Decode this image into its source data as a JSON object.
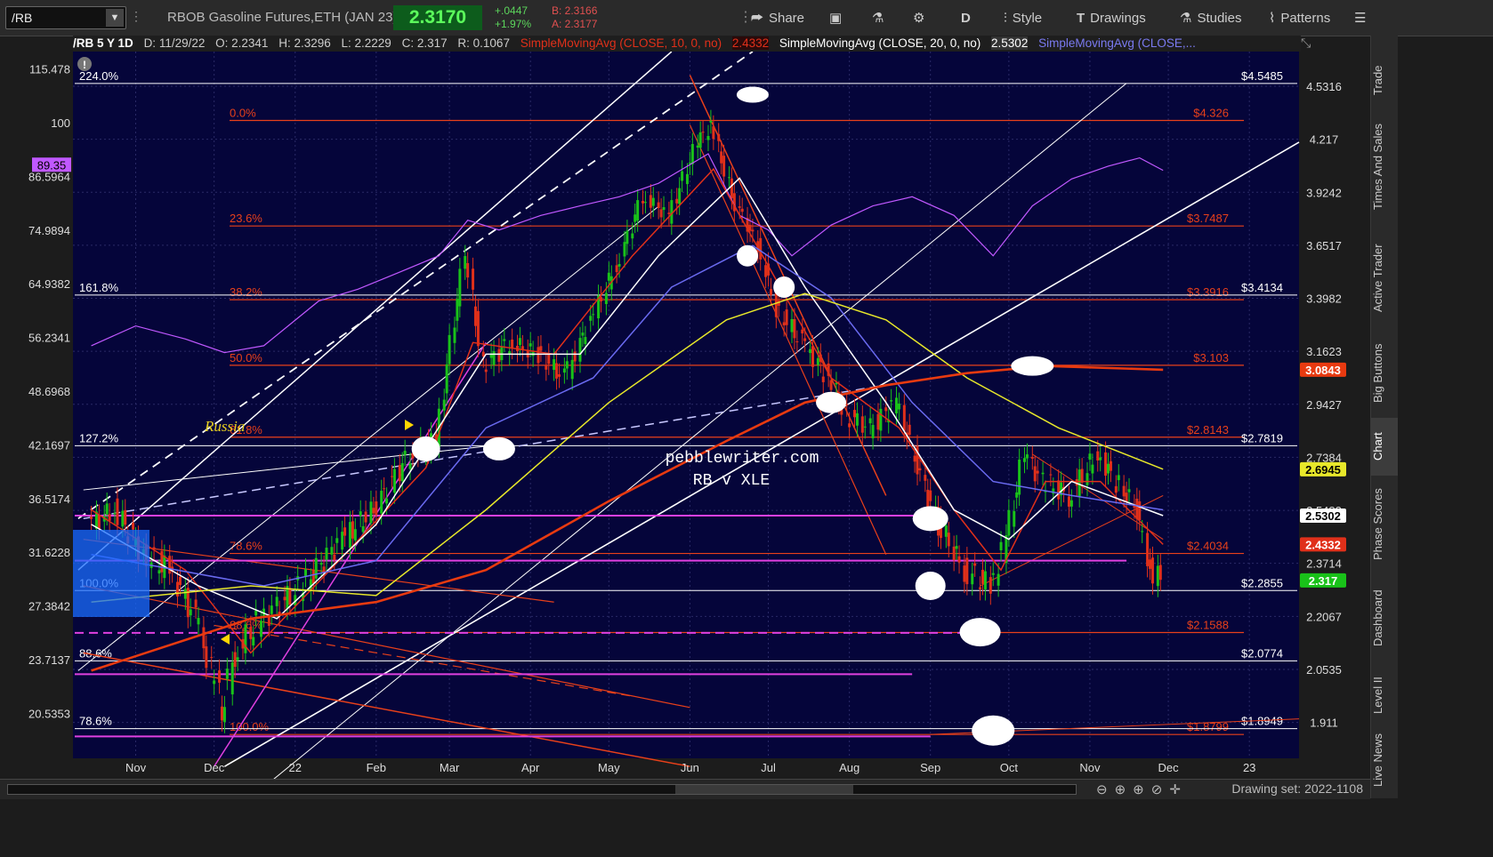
{
  "toolbar": {
    "symbol": "/RB",
    "description": "RBOB Gasoline Futures,ETH (JAN 23)",
    "last_price": "2.3170",
    "change_abs": "+.0447",
    "change_pct": "+1.97%",
    "bid": "B: 2.3166",
    "ask": "A: 2.3177",
    "share_label": "Share",
    "period_label": "D",
    "style_label": "Style",
    "drawings_label": "Drawings",
    "studies_label": "Studies",
    "patterns_label": "Patterns"
  },
  "legend": {
    "header": "/RB 5 Y 1D",
    "date": "D: 11/29/22",
    "open": "O: 2.2341",
    "high": "H: 2.3296",
    "low": "L: 2.2229",
    "close": "C: 2.317",
    "range": "R: 0.1067",
    "sma10": "SimpleMovingAvg (CLOSE, 10, 0, no)",
    "sma10_val": "2.4332",
    "sma20": "SimpleMovingAvg (CLOSE, 20, 0, no)",
    "sma20_val": "2.5302",
    "sma_more": "SimpleMovingAvg (CLOSE,..."
  },
  "colors": {
    "bg": "#05053a",
    "up": "#19c219",
    "down": "#e0301a",
    "sma10": "#e0301a",
    "sma20": "#ffffff",
    "sma50": "#6a6af0",
    "sma100": "#e8e82a",
    "sma200": "#e83a10",
    "xle": "#c058ff",
    "fib": "#e8401a",
    "magenta": "#e040e0"
  },
  "right_tabs": [
    "Trade",
    "Times And Sales",
    "Active Trader",
    "Big Buttons",
    "Chart",
    "Phase Scores",
    "Dashboard",
    "Level II",
    "Live News"
  ],
  "drawing_set": "Drawing set: 2022-1108",
  "chart_data": {
    "type": "candlestick",
    "title": "pebblewriter.com",
    "subtitle": "RB v XLE",
    "annotation": "Russia",
    "x_ticks": [
      {
        "label": "Nov",
        "date": "2021-11-01"
      },
      {
        "label": "Dec",
        "date": "2021-12-01"
      },
      {
        "label": "22",
        "date": "2022-01-01"
      },
      {
        "label": "Feb",
        "date": "2022-02-01"
      },
      {
        "label": "Mar",
        "date": "2022-03-01"
      },
      {
        "label": "Apr",
        "date": "2022-04-01"
      },
      {
        "label": "May",
        "date": "2022-05-01"
      },
      {
        "label": "Jun",
        "date": "2022-06-01"
      },
      {
        "label": "Jul",
        "date": "2022-07-01"
      },
      {
        "label": "Aug",
        "date": "2022-08-01"
      },
      {
        "label": "Sep",
        "date": "2022-09-01"
      },
      {
        "label": "Oct",
        "date": "2022-10-01"
      },
      {
        "label": "Nov",
        "date": "2022-11-01"
      },
      {
        "label": "Dec",
        "date": "2022-12-01"
      },
      {
        "label": "23",
        "date": "2023-01-01"
      }
    ],
    "right_axis": {
      "scale": "log",
      "range": [
        1.82,
        4.75
      ],
      "ticks": [
        "4.5316",
        "4.217",
        "3.9242",
        "3.6517",
        "3.3982",
        "3.1623",
        "2.9427",
        "2.7384",
        "2.5482",
        "2.3714",
        "2.2067",
        "2.0535",
        "1.911"
      ]
    },
    "left_axis": {
      "scale": "log",
      "range": [
        18.2,
        121
      ],
      "ticks": [
        "115.478",
        "100",
        "86.5964",
        "74.9894",
        "64.9382",
        "56.2341",
        "48.6968",
        "42.1697",
        "36.5174",
        "31.6228",
        "27.3842",
        "23.7137",
        "20.5353"
      ]
    },
    "price_tags": [
      {
        "label": "3.0843",
        "value": 3.0843,
        "color": "#e83a10"
      },
      {
        "label": "2.6945",
        "value": 2.6945,
        "color": "#e8e82a"
      },
      {
        "label": "2.5302",
        "value": 2.5302,
        "color": "#ffffff"
      },
      {
        "label": "2.4332",
        "value": 2.4332,
        "color": "#e0301a"
      },
      {
        "label": "2.317",
        "value": 2.317,
        "color": "#19c219"
      }
    ],
    "xle_tag": {
      "label": "89.35",
      "value": 89.35
    },
    "fib_red": [
      {
        "pct": "0.0%",
        "price": "$4.326",
        "value": 4.326
      },
      {
        "pct": "23.6%",
        "price": "$3.7487",
        "value": 3.7487
      },
      {
        "pct": "38.2%",
        "price": "$3.3916",
        "value": 3.3916
      },
      {
        "pct": "50.0%",
        "price": "$3.103",
        "value": 3.103
      },
      {
        "pct": "61.8%",
        "price": "$2.8143",
        "value": 2.8143
      },
      {
        "pct": "78.6%",
        "price": "$2.4034",
        "value": 2.4034
      },
      {
        "pct": "88.6%",
        "price": "$2.1588",
        "value": 2.1588
      },
      {
        "pct": "100.0%",
        "price": "$1.8799",
        "value": 1.8799
      }
    ],
    "fib_white": [
      {
        "pct": "224.0%",
        "price": "$4.5485",
        "value": 4.5485
      },
      {
        "pct": "161.8%",
        "price": "$3.4134",
        "value": 3.4134
      },
      {
        "pct": "127.2%",
        "price": "$2.7819",
        "value": 2.7819
      },
      {
        "pct": "100.0%",
        "price": "$2.2855",
        "value": 2.2855
      },
      {
        "pct": "88.6%",
        "price": "$2.0774",
        "value": 2.0774
      },
      {
        "pct": "78.6%",
        "price": "$1.8949",
        "value": 1.8949
      }
    ],
    "series": [
      {
        "name": "/RB",
        "kind": "close",
        "points": [
          [
            "2021-10-15",
            2.5
          ],
          [
            "2021-10-25",
            2.55
          ],
          [
            "2021-11-05",
            2.4
          ],
          [
            "2021-11-15",
            2.35
          ],
          [
            "2021-11-25",
            2.2
          ],
          [
            "2021-12-01",
            2.05
          ],
          [
            "2021-12-05",
            1.95
          ],
          [
            "2021-12-10",
            2.1
          ],
          [
            "2021-12-20",
            2.2
          ],
          [
            "2022-01-05",
            2.3
          ],
          [
            "2022-01-20",
            2.45
          ],
          [
            "2022-02-01",
            2.55
          ],
          [
            "2022-02-15",
            2.75
          ],
          [
            "2022-02-25",
            2.8
          ],
          [
            "2022-03-05",
            3.4
          ],
          [
            "2022-03-08",
            3.6
          ],
          [
            "2022-03-15",
            3.1
          ],
          [
            "2022-03-25",
            3.2
          ],
          [
            "2022-04-05",
            3.15
          ],
          [
            "2022-04-15",
            3.05
          ],
          [
            "2022-04-25",
            3.3
          ],
          [
            "2022-05-05",
            3.55
          ],
          [
            "2022-05-15",
            3.9
          ],
          [
            "2022-05-25",
            3.8
          ],
          [
            "2022-06-05",
            4.2
          ],
          [
            "2022-06-10",
            4.3
          ],
          [
            "2022-06-18",
            3.9
          ],
          [
            "2022-06-28",
            3.65
          ],
          [
            "2022-07-05",
            3.35
          ],
          [
            "2022-07-15",
            3.2
          ],
          [
            "2022-07-25",
            3.05
          ],
          [
            "2022-08-01",
            2.9
          ],
          [
            "2022-08-10",
            2.85
          ],
          [
            "2022-08-20",
            2.95
          ],
          [
            "2022-08-28",
            2.7
          ],
          [
            "2022-09-05",
            2.5
          ],
          [
            "2022-09-15",
            2.35
          ],
          [
            "2022-09-25",
            2.3
          ],
          [
            "2022-10-01",
            2.45
          ],
          [
            "2022-10-08",
            2.75
          ],
          [
            "2022-10-15",
            2.65
          ],
          [
            "2022-10-25",
            2.6
          ],
          [
            "2022-11-05",
            2.75
          ],
          [
            "2022-11-12",
            2.65
          ],
          [
            "2022-11-20",
            2.55
          ],
          [
            "2022-11-25",
            2.35
          ],
          [
            "2022-11-29",
            2.317
          ]
        ]
      },
      {
        "name": "XLE",
        "kind": "overlay",
        "points": [
          [
            "2021-10-15",
            55
          ],
          [
            "2021-11-01",
            58
          ],
          [
            "2021-11-20",
            56
          ],
          [
            "2021-12-05",
            54
          ],
          [
            "2021-12-20",
            55
          ],
          [
            "2022-01-10",
            62
          ],
          [
            "2022-01-25",
            64
          ],
          [
            "2022-02-10",
            67
          ],
          [
            "2022-02-25",
            70
          ],
          [
            "2022-03-08",
            77
          ],
          [
            "2022-03-20",
            75
          ],
          [
            "2022-04-05",
            78
          ],
          [
            "2022-04-20",
            80
          ],
          [
            "2022-05-05",
            82
          ],
          [
            "2022-05-20",
            85
          ],
          [
            "2022-06-08",
            92
          ],
          [
            "2022-06-20",
            78
          ],
          [
            "2022-07-01",
            75
          ],
          [
            "2022-07-10",
            70
          ],
          [
            "2022-07-25",
            76
          ],
          [
            "2022-08-10",
            80
          ],
          [
            "2022-08-25",
            82
          ],
          [
            "2022-09-10",
            78
          ],
          [
            "2022-09-25",
            70
          ],
          [
            "2022-10-10",
            80
          ],
          [
            "2022-10-25",
            86
          ],
          [
            "2022-11-08",
            89
          ],
          [
            "2022-11-20",
            91
          ],
          [
            "2022-11-29",
            88
          ]
        ]
      },
      {
        "name": "SMA10",
        "kind": "sma",
        "points": [
          [
            "2021-10-15",
            2.55
          ],
          [
            "2021-11-20",
            2.35
          ],
          [
            "2021-12-15",
            2.1
          ],
          [
            "2022-01-20",
            2.4
          ],
          [
            "2022-02-20",
            2.7
          ],
          [
            "2022-03-10",
            3.2
          ],
          [
            "2022-04-10",
            3.15
          ],
          [
            "2022-05-10",
            3.6
          ],
          [
            "2022-06-10",
            4.05
          ],
          [
            "2022-07-01",
            3.55
          ],
          [
            "2022-07-25",
            3.05
          ],
          [
            "2022-08-20",
            2.85
          ],
          [
            "2022-09-10",
            2.55
          ],
          [
            "2022-09-28",
            2.35
          ],
          [
            "2022-10-15",
            2.65
          ],
          [
            "2022-11-05",
            2.65
          ],
          [
            "2022-11-29",
            2.4332
          ]
        ]
      },
      {
        "name": "SMA20",
        "kind": "sma",
        "points": [
          [
            "2021-10-15",
            2.5
          ],
          [
            "2021-11-25",
            2.3
          ],
          [
            "2021-12-25",
            2.2
          ],
          [
            "2022-02-01",
            2.5
          ],
          [
            "2022-03-15",
            3.15
          ],
          [
            "2022-04-20",
            3.15
          ],
          [
            "2022-05-20",
            3.6
          ],
          [
            "2022-06-20",
            4.0
          ],
          [
            "2022-07-15",
            3.45
          ],
          [
            "2022-08-15",
            2.95
          ],
          [
            "2022-09-10",
            2.55
          ],
          [
            "2022-10-01",
            2.45
          ],
          [
            "2022-10-25",
            2.65
          ],
          [
            "2022-11-29",
            2.5302
          ]
        ]
      },
      {
        "name": "SMA50",
        "kind": "sma",
        "points": [
          [
            "2021-10-15",
            2.4
          ],
          [
            "2021-12-20",
            2.3
          ],
          [
            "2022-02-01",
            2.38
          ],
          [
            "2022-03-15",
            2.85
          ],
          [
            "2022-04-25",
            3.05
          ],
          [
            "2022-05-25",
            3.45
          ],
          [
            "2022-06-25",
            3.65
          ],
          [
            "2022-07-25",
            3.4
          ],
          [
            "2022-08-25",
            2.95
          ],
          [
            "2022-09-25",
            2.65
          ],
          [
            "2022-10-25",
            2.6
          ],
          [
            "2022-11-29",
            2.55
          ]
        ]
      },
      {
        "name": "SMA100",
        "kind": "sma",
        "points": [
          [
            "2021-10-15",
            2.25
          ],
          [
            "2021-12-15",
            2.3
          ],
          [
            "2022-02-01",
            2.27
          ],
          [
            "2022-03-15",
            2.55
          ],
          [
            "2022-05-01",
            2.95
          ],
          [
            "2022-06-15",
            3.3
          ],
          [
            "2022-07-15",
            3.42
          ],
          [
            "2022-08-15",
            3.3
          ],
          [
            "2022-09-15",
            3.05
          ],
          [
            "2022-10-20",
            2.85
          ],
          [
            "2022-11-29",
            2.6945
          ]
        ]
      },
      {
        "name": "SMA200",
        "kind": "sma",
        "points": [
          [
            "2021-10-15",
            2.05
          ],
          [
            "2021-12-15",
            2.2
          ],
          [
            "2022-02-01",
            2.25
          ],
          [
            "2022-03-15",
            2.35
          ],
          [
            "2022-05-01",
            2.58
          ],
          [
            "2022-06-15",
            2.8
          ],
          [
            "2022-07-15",
            2.95
          ],
          [
            "2022-08-15",
            3.02
          ],
          [
            "2022-09-15",
            3.07
          ],
          [
            "2022-10-15",
            3.1
          ],
          [
            "2022-11-29",
            3.0843
          ]
        ]
      }
    ]
  }
}
